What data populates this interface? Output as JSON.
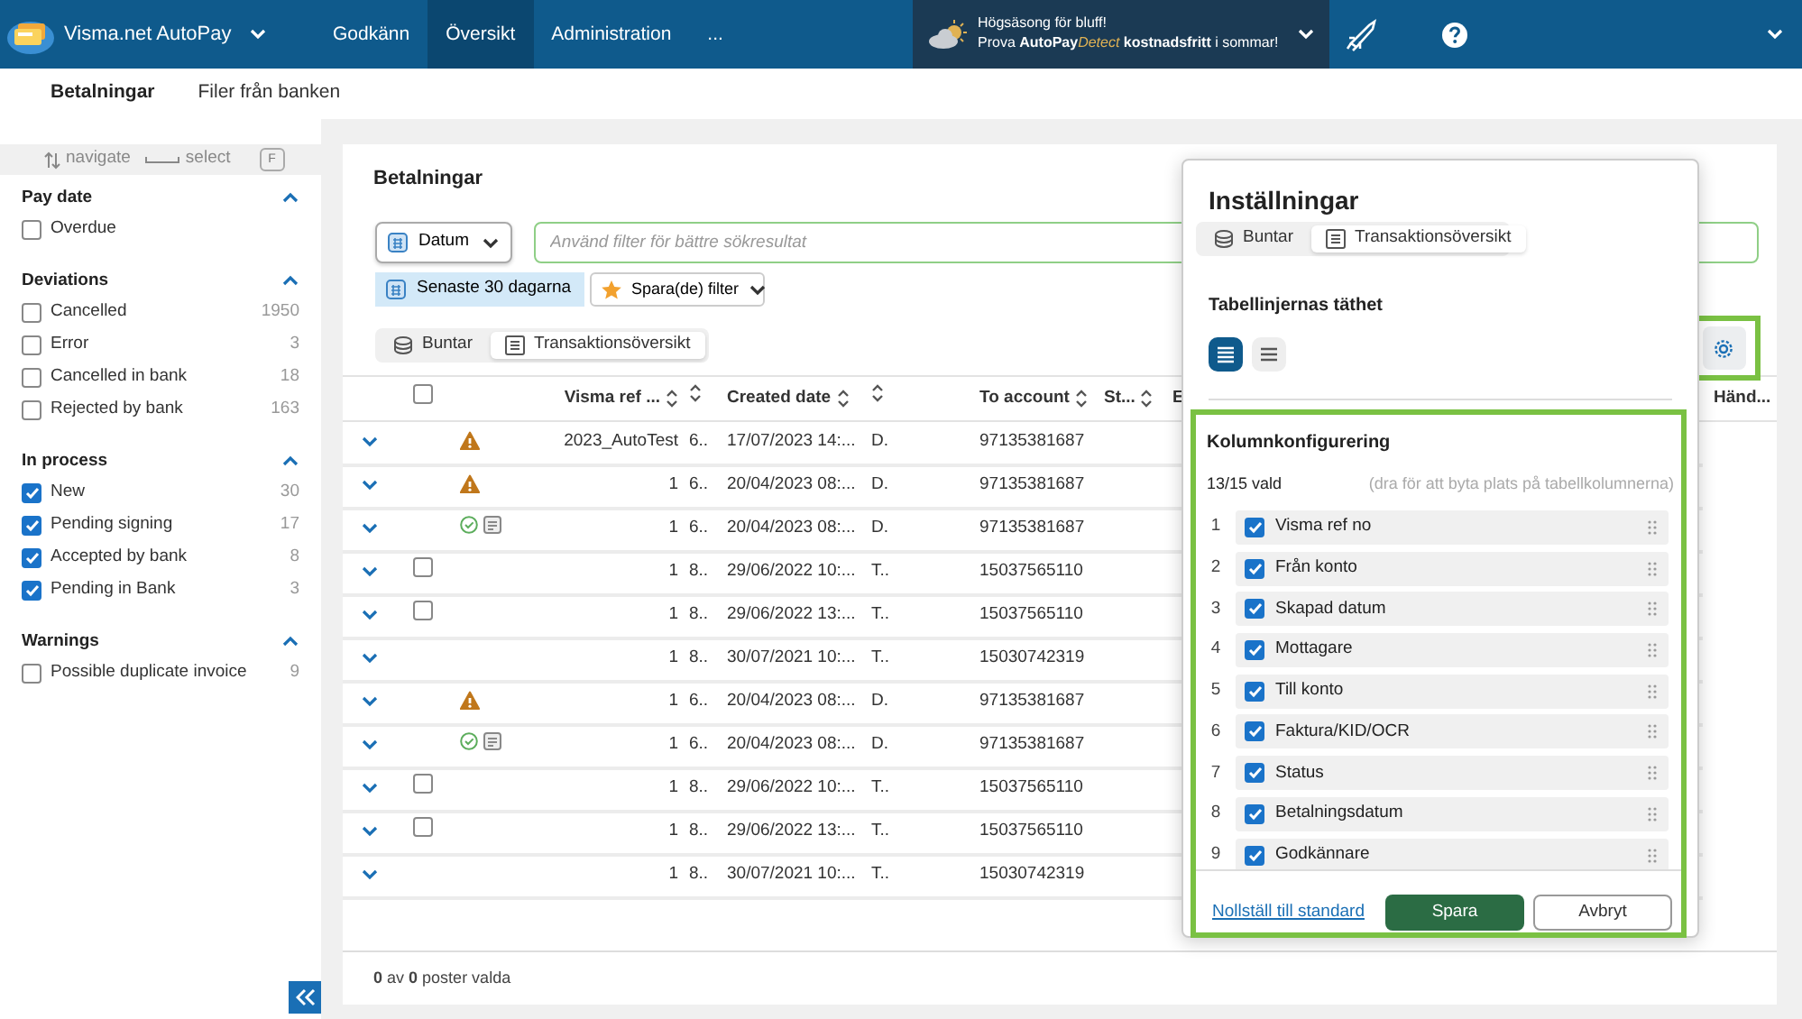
{
  "app": {
    "name": "Visma.net AutoPay"
  },
  "nav": [
    {
      "label": "Godkänn",
      "selected": false
    },
    {
      "label": "Översikt",
      "selected": true
    },
    {
      "label": "Administration",
      "selected": false
    },
    {
      "label": "...",
      "selected": false
    }
  ],
  "promo": {
    "line1": "Högsäsong för bluff!",
    "line2": [
      {
        "kind": "plain",
        "text": "Prova "
      },
      {
        "kind": "bold",
        "text": "AutoPay"
      },
      {
        "kind": "accent",
        "text": "Detect"
      },
      {
        "kind": "bold",
        "text": " kostnadsfritt"
      },
      {
        "kind": "plain",
        "text": " i sommar!"
      }
    ]
  },
  "subnav": [
    {
      "label": "Betalningar",
      "selected": true
    },
    {
      "label": "Filer från banken",
      "selected": false
    }
  ],
  "sidebar": {
    "hints": [
      {
        "kind": "arrows",
        "label": "navigate"
      },
      {
        "kind": "space",
        "label": "select"
      }
    ],
    "key": "F",
    "groups": [
      {
        "title": "Pay date",
        "expanded": true,
        "items": [
          {
            "label": "Overdue",
            "checked": false
          }
        ]
      },
      {
        "title": "Deviations",
        "expanded": true,
        "items": [
          {
            "label": "Cancelled",
            "count": "1950",
            "checked": false
          },
          {
            "label": "Error",
            "count": "3",
            "checked": false
          },
          {
            "label": "Cancelled in bank",
            "count": "18",
            "checked": false
          },
          {
            "label": "Rejected by bank",
            "count": "163",
            "checked": false
          }
        ]
      },
      {
        "title": "In process",
        "expanded": true,
        "items": [
          {
            "label": "New",
            "count": "30",
            "checked": true
          },
          {
            "label": "Pending signing",
            "count": "17",
            "checked": true
          },
          {
            "label": "Accepted by bank",
            "count": "8",
            "checked": true
          },
          {
            "label": "Pending in Bank",
            "count": "3",
            "checked": true
          }
        ]
      },
      {
        "title": "Warnings",
        "expanded": true,
        "items": [
          {
            "label": "Possible duplicate invoice",
            "count": "9",
            "checked": false
          }
        ]
      }
    ]
  },
  "page": {
    "title": "Betalningar",
    "date_filter": "Datum",
    "search": {
      "placeholder": "Använd filter för bättre sökresultat"
    },
    "period": "Senaste 30 dagarna",
    "saved_filter": "Spara(de) filter",
    "views": [
      {
        "kind": "batch",
        "label": "Buntar",
        "selected": false
      },
      {
        "kind": "list",
        "label": "Transaktionsöversikt",
        "selected": true
      }
    ],
    "table": {
      "select_all": {
        "checked": false
      },
      "columns": [
        {
          "label": "Visma ref ..."
        },
        {},
        {
          "label": "Created date"
        },
        {},
        {
          "label": "To account"
        },
        {
          "label": "St..."
        },
        {
          "label": "E"
        },
        {
          "label": "Händ..."
        }
      ],
      "rows": [
        {
          "kind": "warning",
          "cells": [
            "2023_AutoTest",
            "6..",
            "17/07/2023 14:...",
            "D.",
            "97135381687"
          ]
        },
        {
          "kind": "warning",
          "cells": [
            "1",
            "6..",
            "20/04/2023 08:...",
            "D.",
            "97135381687"
          ]
        },
        {
          "kind": "approved",
          "cells": [
            "1",
            "6..",
            "20/04/2023 08:...",
            "D.",
            "97135381687"
          ]
        },
        {
          "kind": "checkbox",
          "checked": false,
          "cells": [
            "1",
            "8..",
            "29/06/2022 10:...",
            "T..",
            "15037565110"
          ]
        },
        {
          "kind": "checkbox",
          "checked": false,
          "cells": [
            "1",
            "8..",
            "29/06/2022 13:...",
            "T..",
            "15037565110"
          ]
        },
        {
          "kind": "none",
          "cells": [
            "1",
            "8..",
            "30/07/2021 10:...",
            "T..",
            "15030742319"
          ]
        },
        {
          "kind": "warning",
          "cells": [
            "1",
            "6..",
            "20/04/2023 08:...",
            "D.",
            "97135381687"
          ]
        },
        {
          "kind": "approved",
          "cells": [
            "1",
            "6..",
            "20/04/2023 08:...",
            "D.",
            "97135381687"
          ]
        },
        {
          "kind": "checkbox",
          "checked": false,
          "cells": [
            "1",
            "8..",
            "29/06/2022 10:...",
            "T..",
            "15037565110"
          ]
        },
        {
          "kind": "checkbox",
          "checked": false,
          "cells": [
            "1",
            "8..",
            "29/06/2022 13:...",
            "T..",
            "15037565110"
          ]
        },
        {
          "kind": "none",
          "cells": [
            "1",
            "8..",
            "30/07/2021 10:...",
            "T..",
            "15030742319"
          ]
        }
      ]
    },
    "footer": "**0** av **0** poster valda"
  },
  "settings": {
    "title": "Inställningar",
    "views": [
      {
        "kind": "batch",
        "label": "Buntar",
        "selected": false
      },
      {
        "kind": "list",
        "label": "Transaktionsöversikt",
        "selected": true
      }
    ],
    "density_title": "Tabellinjernas täthet",
    "density": [
      {
        "kind": "compact",
        "selected": true
      },
      {
        "kind": "normal",
        "selected": false
      }
    ],
    "columns_title": "Kolumnkonfigurering",
    "count": "13/15 vald",
    "hint": "(dra för att byta plats på tabellkolumnerna)",
    "columns": [
      {
        "number": "1",
        "label": "Visma ref no",
        "checked": true
      },
      {
        "number": "2",
        "label": "Från konto",
        "checked": true
      },
      {
        "number": "3",
        "label": "Skapad datum",
        "checked": true
      },
      {
        "number": "4",
        "label": "Mottagare",
        "checked": true
      },
      {
        "number": "5",
        "label": "Till konto",
        "checked": true
      },
      {
        "number": "6",
        "label": "Faktura/KID/OCR",
        "checked": true
      },
      {
        "number": "7",
        "label": "Status",
        "checked": true
      },
      {
        "number": "8",
        "label": "Betalningsdatum",
        "checked": true
      },
      {
        "number": "9",
        "label": "Godkännare",
        "checked": true
      }
    ],
    "reset": "Nollställ till standard",
    "save": "Spara",
    "cancel": "Avbryt"
  }
}
